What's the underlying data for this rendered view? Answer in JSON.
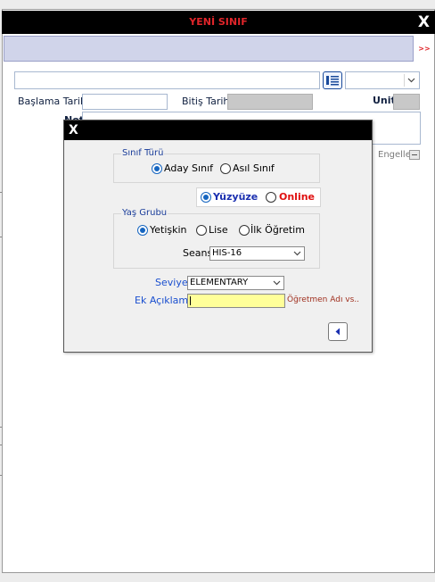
{
  "window": {
    "title": "YENİ SINIF",
    "close_label": "X",
    "more_label": ">>"
  },
  "form": {
    "search_value": "",
    "start_date_label": "Başlama Tarihi",
    "start_date_value": "",
    "end_date_label": "Bitiş Tarihi",
    "end_date_value": "",
    "unit_label": "Unit",
    "note_label": "Not",
    "block_label": "Engelle"
  },
  "dialog": {
    "close_label": "X",
    "class_type": {
      "legend": "Sınıf Türü",
      "options": [
        "Aday Sınıf",
        "Asıl Sınıf"
      ],
      "selected": "Aday Sınıf"
    },
    "mode": {
      "options": [
        "Yüzyüze",
        "Online"
      ],
      "selected": "Yüzyüze",
      "colors": {
        "Yüzyüze": "#1a2fb0",
        "Online": "#e01010"
      }
    },
    "age_group": {
      "legend": "Yaş Grubu",
      "options": [
        "Yetişkin",
        "Lise",
        "İlk Öğretim"
      ],
      "selected": "Yetişkin"
    },
    "session": {
      "label": "Seans",
      "value": "HIS-16"
    },
    "level": {
      "label": "Seviye",
      "value": "ELEMENTARY"
    },
    "extra": {
      "label": "Ek Açıklama",
      "value": "",
      "hint": "Öğretmen Adı vs.."
    }
  },
  "colors": {
    "title": "#e0252a",
    "accent": "#1565c0",
    "label_blue": "#1a4fcf"
  }
}
